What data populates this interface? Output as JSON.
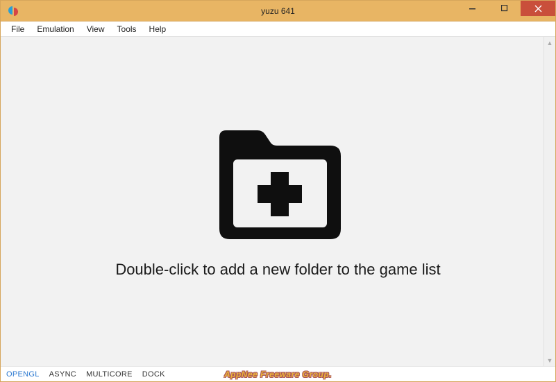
{
  "titlebar": {
    "title": "yuzu 641"
  },
  "menu": {
    "items": [
      "File",
      "Emulation",
      "View",
      "Tools",
      "Help"
    ]
  },
  "content": {
    "empty_message": "Double-click to add a new folder to the game list"
  },
  "statusbar": {
    "items": [
      {
        "label": "OPENGL",
        "active": true
      },
      {
        "label": "ASYNC",
        "active": false
      },
      {
        "label": "MULTICORE",
        "active": false
      },
      {
        "label": "DOCK",
        "active": false
      }
    ]
  },
  "watermark": "AppNee Freeware Group."
}
